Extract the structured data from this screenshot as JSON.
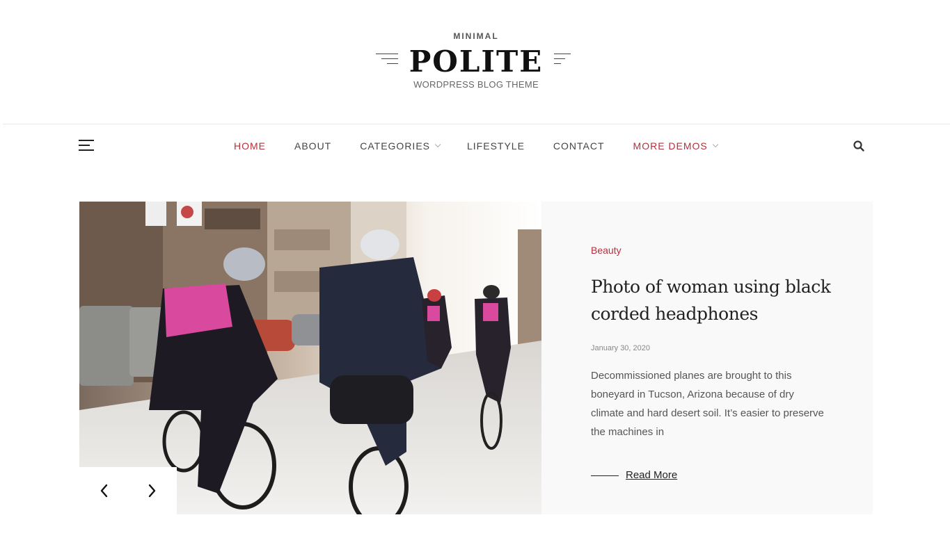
{
  "logo": {
    "tagline": "MINIMAL",
    "title": "POLITE",
    "subtitle": "WORDPRESS BLOG THEME"
  },
  "nav": {
    "items": [
      {
        "label": "HOME",
        "state": "active"
      },
      {
        "label": "ABOUT"
      },
      {
        "label": "CATEGORIES",
        "dropdown": true
      },
      {
        "label": "LIFESTYLE"
      },
      {
        "label": "CONTACT"
      },
      {
        "label": "MORE DEMOS",
        "dropdown": true,
        "highlight": true
      }
    ],
    "menu_icon": "hamburger-icon",
    "search_icon": "search-icon"
  },
  "slide": {
    "image_subject": "cyclists riding on a sunny city street",
    "category": "Beauty",
    "title": "Photo of woman using black corded headphones",
    "date": "January 30, 2020",
    "excerpt": "Decommissioned planes are brought to this boneyard in Tucson, Arizona because of dry climate and hard desert soil. It’s easier to preserve the machines in",
    "read_more": "Read More",
    "prev_icon": "chevron-left-icon",
    "next_icon": "chevron-right-icon"
  },
  "colors": {
    "accent": "#b5303a",
    "text": "#222222",
    "muted": "#555555",
    "panel_bg": "#f9f9f9"
  }
}
